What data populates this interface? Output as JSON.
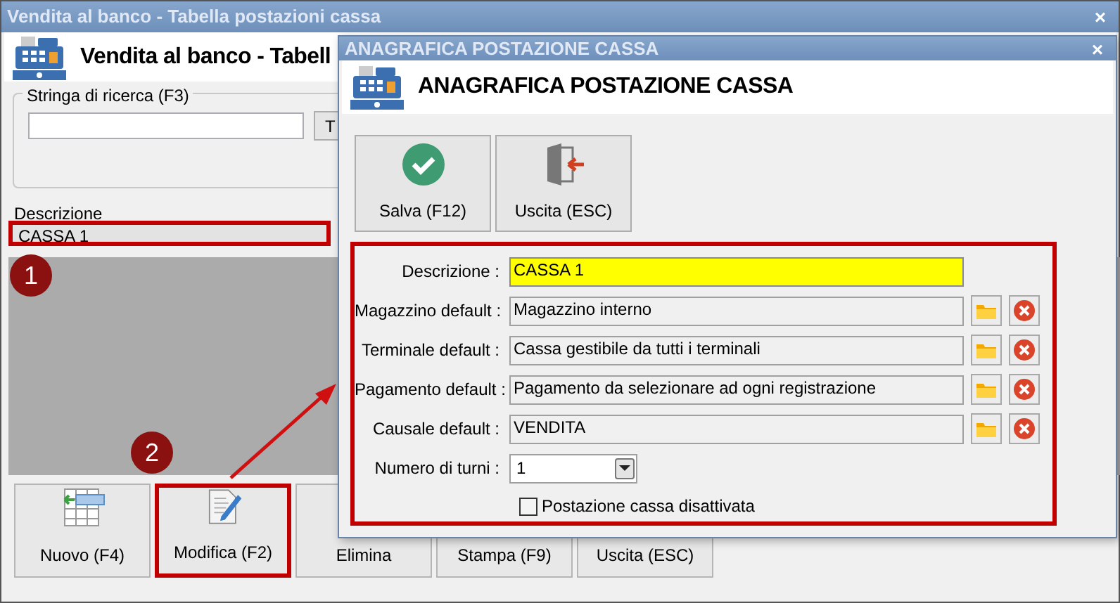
{
  "main_window": {
    "title": "Vendita al banco - Tabella postazioni cassa",
    "close": "×",
    "header_title": "Vendita al banco - Tabell",
    "search": {
      "legend": "Stringa di ricerca (F3)",
      "button": "T"
    },
    "table": {
      "columns": [
        "Descrizione"
      ],
      "rows": [
        {
          "cells": [
            "CASSA 1"
          ],
          "selected": true,
          "highlighted": true
        }
      ]
    },
    "buttons": [
      {
        "label": "Nuovo (F4)",
        "kind": "new",
        "highlighted": false
      },
      {
        "label": "Modifica (F2)",
        "kind": "edit",
        "highlighted": true
      },
      {
        "label": "Elimina",
        "kind": "hidden",
        "highlighted": false
      },
      {
        "label": "Stampa (F9)",
        "kind": "hidden",
        "highlighted": false
      },
      {
        "label": "Uscita (ESC)",
        "kind": "hidden",
        "highlighted": false
      }
    ]
  },
  "dialog": {
    "title": "ANAGRAFICA POSTAZIONE CASSA",
    "close": "×",
    "header_title": "ANAGRAFICA POSTAZIONE CASSA",
    "buttons": [
      {
        "label": "Salva (F12)",
        "kind": "save"
      },
      {
        "label": "Uscita (ESC)",
        "kind": "exit"
      }
    ],
    "form_highlighted": true,
    "fields": [
      {
        "label": "Descrizione :",
        "value": "CASSA 1",
        "kind": "text",
        "focused": true
      },
      {
        "label": "Magazzino default :",
        "value": "Magazzino interno",
        "kind": "lookup",
        "focused": false
      },
      {
        "label": "Terminale default :",
        "value": "Cassa gestibile da tutti i terminali",
        "kind": "lookup",
        "focused": false
      },
      {
        "label": "Pagamento default :",
        "value": "Pagamento da selezionare ad ogni registrazione",
        "kind": "lookup",
        "focused": false
      },
      {
        "label": "Causale default :",
        "value": "VENDITA",
        "kind": "lookup",
        "focused": false
      },
      {
        "label": "Numero di turni :",
        "value": "1",
        "kind": "select"
      }
    ],
    "checkbox": {
      "label": "Postazione cassa disattivata",
      "checked": false
    }
  },
  "annotations": [
    {
      "number": "1"
    },
    {
      "number": "2"
    }
  ]
}
